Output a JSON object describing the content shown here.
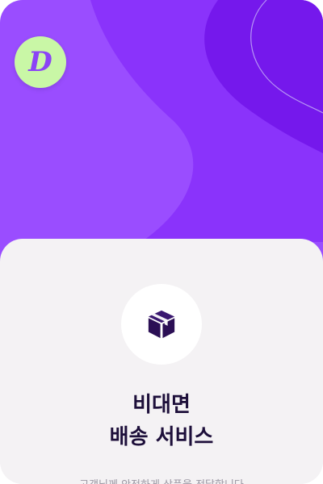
{
  "brand": {
    "logo_letter": "D",
    "logo_bg": "#c9f7a6",
    "logo_color": "#8b43f6"
  },
  "colors": {
    "hero_primary": "#9a4dff",
    "hero_secondary": "#8a33fb",
    "hero_dark": "#7518ec",
    "sheet_bg": "#f4f2f4",
    "title_color": "#1d0f3a",
    "icon_color": "#2b0f55"
  },
  "feature": {
    "icon": "package-box-icon",
    "title_line1": "비대면",
    "title_line2": "배송 서비스",
    "subtitle": "고객님께 안전하게 상품을 전달합니다"
  }
}
